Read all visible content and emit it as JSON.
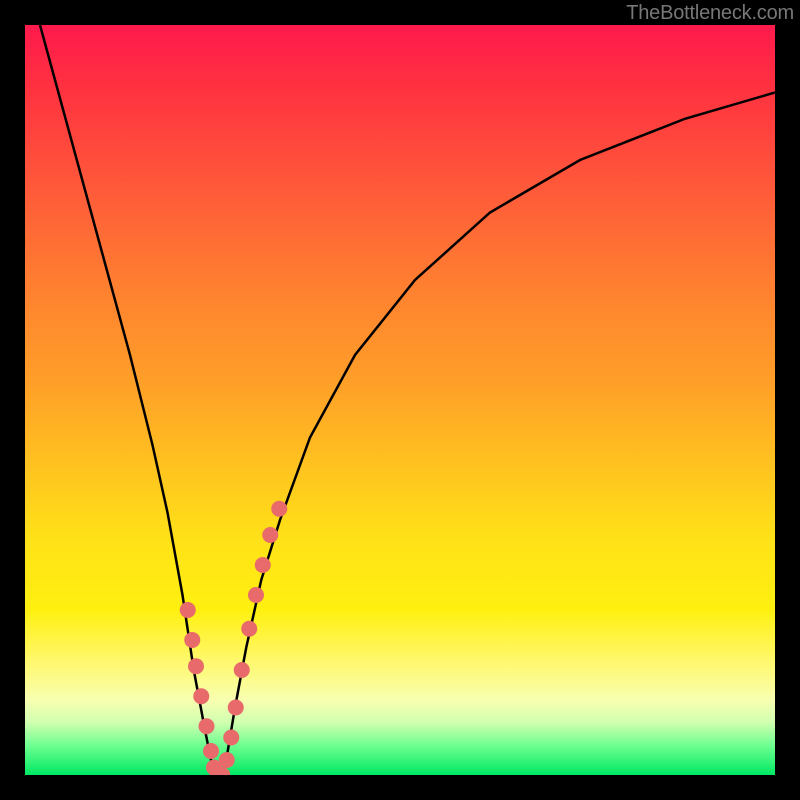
{
  "watermark": {
    "text": "TheBottleneck.com"
  },
  "chart_data": {
    "type": "line",
    "title": "",
    "xlabel": "",
    "ylabel": "",
    "xlim": [
      0,
      100
    ],
    "ylim": [
      0,
      100
    ],
    "series": [
      {
        "name": "curve",
        "x": [
          2,
          5,
          8,
          11,
          14,
          17,
          19,
          21,
          22.5,
          24,
          25,
          25.7,
          26.3,
          27,
          28,
          29.5,
          31.5,
          34,
          38,
          44,
          52,
          62,
          74,
          88,
          100
        ],
        "y": [
          100,
          89,
          78,
          67,
          56,
          44,
          35,
          24,
          14,
          6,
          1,
          0,
          0,
          3,
          9,
          17,
          26,
          34,
          45,
          56,
          66,
          75,
          82,
          87.5,
          91
        ]
      }
    ],
    "scatter": {
      "name": "dots",
      "x": [
        21.7,
        22.3,
        22.8,
        23.5,
        24.2,
        24.8,
        25.2,
        25.7,
        26.3,
        26.9,
        27.5,
        28.1,
        28.9,
        29.9,
        30.8,
        31.7,
        32.7,
        33.9
      ],
      "y": [
        22.0,
        18.0,
        14.5,
        10.5,
        6.5,
        3.2,
        1.0,
        0.0,
        0.0,
        2.0,
        5.0,
        9.0,
        14.0,
        19.5,
        24.0,
        28.0,
        32.0,
        35.5
      ]
    },
    "gradient_stops": [
      {
        "pct": 0,
        "color": "#ff1a4d"
      },
      {
        "pct": 8,
        "color": "#ff3040"
      },
      {
        "pct": 22,
        "color": "#ff5a3a"
      },
      {
        "pct": 35,
        "color": "#ff8030"
      },
      {
        "pct": 48,
        "color": "#ffa028"
      },
      {
        "pct": 58,
        "color": "#ffc020"
      },
      {
        "pct": 68,
        "color": "#ffe018"
      },
      {
        "pct": 78,
        "color": "#fff010"
      },
      {
        "pct": 85,
        "color": "#fff870"
      },
      {
        "pct": 90,
        "color": "#f8ffb0"
      },
      {
        "pct": 93,
        "color": "#d0ffb0"
      },
      {
        "pct": 96,
        "color": "#70ff90"
      },
      {
        "pct": 100,
        "color": "#00e864"
      }
    ],
    "colors": {
      "curve": "#000000",
      "dots": "#e86a6a",
      "frame": "#000000"
    }
  }
}
